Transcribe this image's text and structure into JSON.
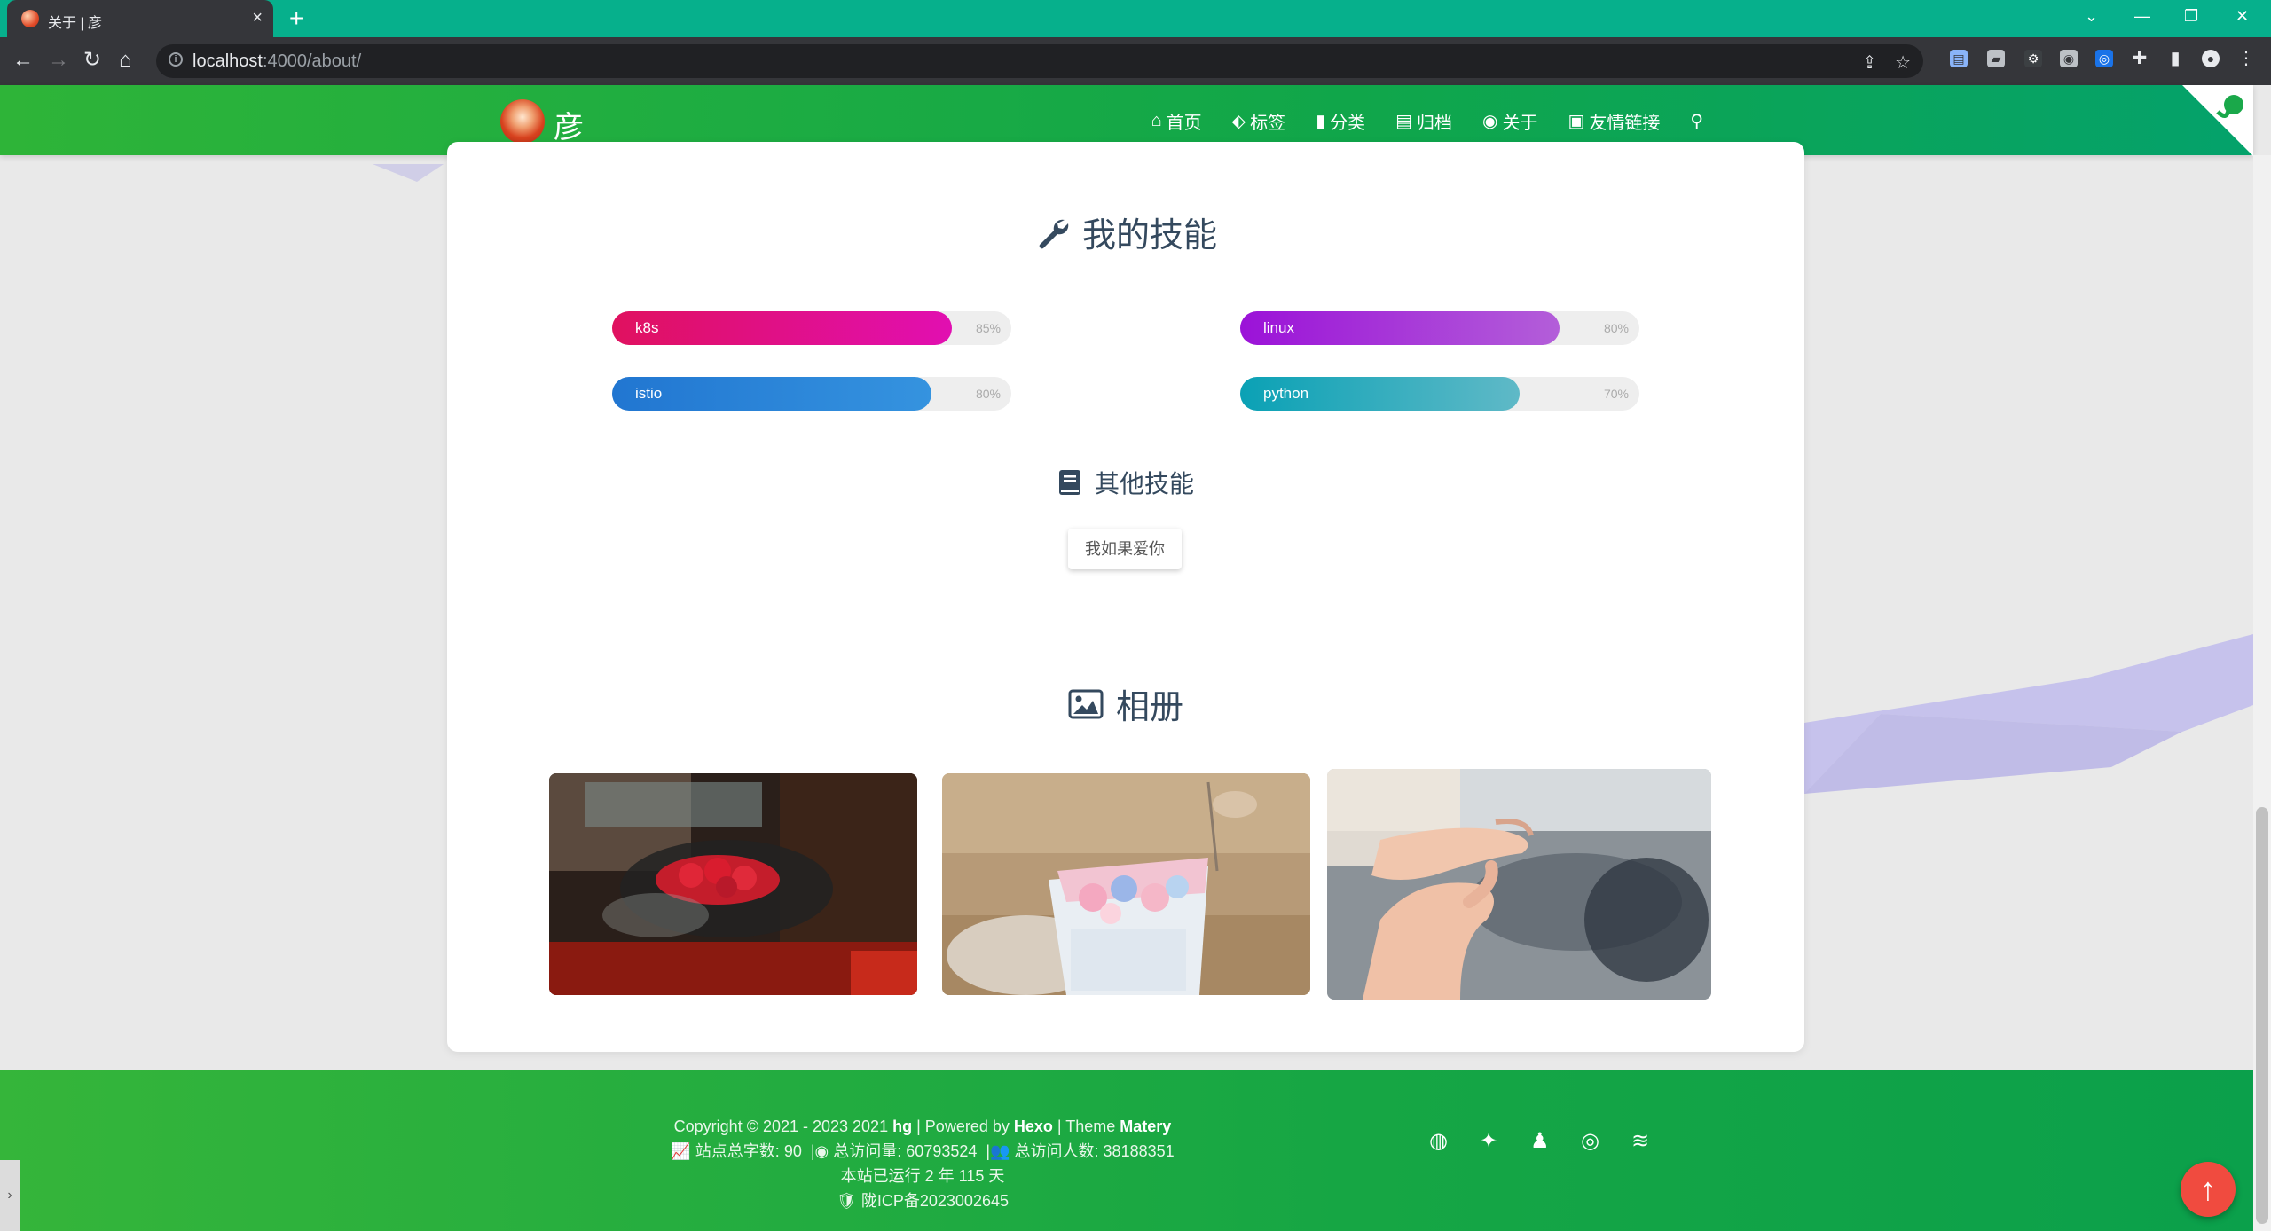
{
  "browser": {
    "tab_title": "关于 | 彦",
    "tab_close": "×",
    "new_tab": "+",
    "url_host": "localhost",
    "url_rest": ":4000/about/",
    "win_min": "—",
    "win_restore": "❐",
    "win_close": "✕",
    "tab_menu": "⌄"
  },
  "site": {
    "logo_text": "彦",
    "nav": [
      {
        "label": "首页",
        "icon": "home-icon"
      },
      {
        "label": "标签",
        "icon": "tags-icon"
      },
      {
        "label": "分类",
        "icon": "bookmark-icon"
      },
      {
        "label": "归档",
        "icon": "archive-icon"
      },
      {
        "label": "关于",
        "icon": "user-circle-icon"
      },
      {
        "label": "友情链接",
        "icon": "address-book-icon"
      }
    ]
  },
  "skills": {
    "title": "我的技能",
    "items": [
      {
        "label": "k8s",
        "percent": 85,
        "percent_text": "85%",
        "gradient": [
          "#e0115f",
          "#e10fb1"
        ]
      },
      {
        "label": "linux",
        "percent": 80,
        "percent_text": "80%",
        "gradient": [
          "#9b12d8",
          "#b35ed9"
        ]
      },
      {
        "label": "istio",
        "percent": 80,
        "percent_text": "80%",
        "gradient": [
          "#2176d1",
          "#3593df"
        ]
      },
      {
        "label": "python",
        "percent": 70,
        "percent_text": "70%",
        "gradient": [
          "#0aa1b5",
          "#5fb9c7"
        ]
      }
    ]
  },
  "other_skills": {
    "title": "其他技能",
    "chip": "我如果爱你"
  },
  "album": {
    "title": "相册"
  },
  "footer": {
    "copyright_prefix": "Copyright © 2021 - 2023 2021",
    "author": "hg",
    "powered_by": "| Powered by",
    "hexo": "Hexo",
    "theme": "| Theme",
    "matery": "Matery",
    "word_count_label": "站点总字数:",
    "word_count": "90",
    "pv_label": "总访问量:",
    "pv": "60793524",
    "uv_label": "总访问人数:",
    "uv": "38188351",
    "uptime": "本站已运行 2 年 115 天",
    "icp": "陇ICP备2023002645"
  },
  "colors": {
    "header_green": "#2eb438",
    "footer_green": "#16a644",
    "totop_red": "#f04b3f"
  }
}
